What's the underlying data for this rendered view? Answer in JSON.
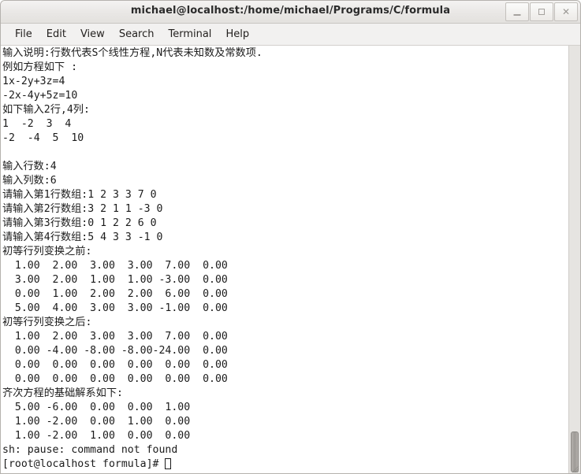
{
  "window": {
    "title": "michael@localhost:/home/michael/Programs/C/formula",
    "controls": [
      {
        "name": "minimize",
        "glyph": "–"
      },
      {
        "name": "maximize",
        "glyph": "□"
      },
      {
        "name": "close",
        "glyph": "✕"
      }
    ]
  },
  "menubar": {
    "items": [
      {
        "label": "File"
      },
      {
        "label": "Edit"
      },
      {
        "label": "View"
      },
      {
        "label": "Search"
      },
      {
        "label": "Terminal"
      },
      {
        "label": "Help"
      }
    ]
  },
  "terminal": {
    "prompt": "[root@localhost formula]# ",
    "lines": [
      "输入说明:行数代表S个线性方程,N代表未知数及常数项.",
      "例如方程如下 :",
      "1x-2y+3z=4",
      "-2x-4y+5z=10",
      "如下输入2行,4列:",
      "1  -2  3  4",
      "-2  -4  5  10",
      "",
      "输入行数:4",
      "输入列数:6",
      "请输入第1行数组:1 2 3 3 7 0",
      "请输入第2行数组:3 2 1 1 -3 0",
      "请输入第3行数组:0 1 2 2 6 0",
      "请输入第4行数组:5 4 3 3 -1 0",
      "初等行列变换之前:",
      "  1.00  2.00  3.00  3.00  7.00  0.00",
      "  3.00  2.00  1.00  1.00 -3.00  0.00",
      "  0.00  1.00  2.00  2.00  6.00  0.00",
      "  5.00  4.00  3.00  3.00 -1.00  0.00",
      "初等行列变换之后:",
      "  1.00  2.00  3.00  3.00  7.00  0.00",
      "  0.00 -4.00 -8.00 -8.00-24.00  0.00",
      "  0.00  0.00  0.00  0.00  0.00  0.00",
      "  0.00  0.00  0.00  0.00  0.00  0.00",
      "齐次方程的基础解系如下:",
      "  5.00 -6.00  0.00  0.00  1.00",
      "  1.00 -2.00  0.00  1.00  0.00",
      "  1.00 -2.00  1.00  0.00  0.00",
      "sh: pause: command not found"
    ]
  },
  "scrollbar": {
    "position": "near-bottom"
  }
}
